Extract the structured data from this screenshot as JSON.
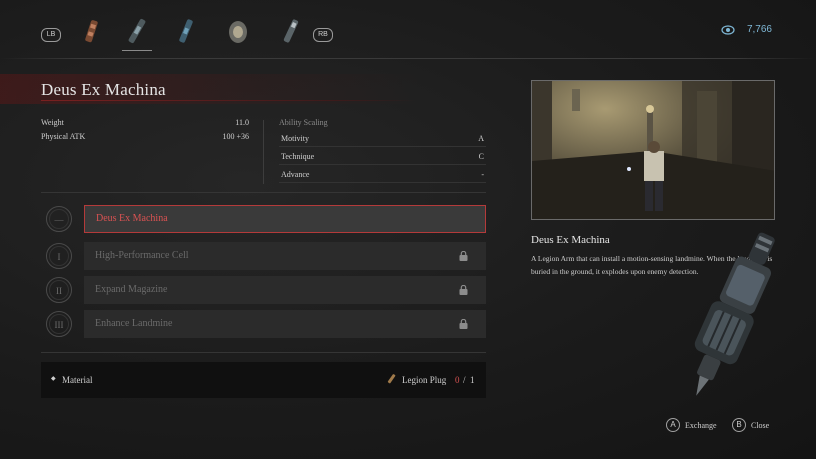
{
  "topbar": {
    "lb": "LB",
    "rb": "RB",
    "tabs": [
      "arm-1",
      "arm-2",
      "arm-3",
      "arm-4",
      "arm-5"
    ],
    "active_tab": 1,
    "currency": "7,766"
  },
  "weapon": {
    "name": "Deus Ex Machina",
    "stats": [
      {
        "label": "Weight",
        "value": "11.0"
      },
      {
        "label": "Physical ATK",
        "value": "100 +36"
      }
    ],
    "scaling_label": "Ability Scaling",
    "scaling": [
      {
        "label": "Motivity",
        "value": "A"
      },
      {
        "label": "Technique",
        "value": "C"
      },
      {
        "label": "Advance",
        "value": "-"
      }
    ]
  },
  "upgrades": [
    {
      "numeral": "—",
      "label": "Deus Ex Machina",
      "locked": false,
      "active": true
    },
    {
      "numeral": "I",
      "label": "High-Performance Cell",
      "locked": true,
      "active": false
    },
    {
      "numeral": "II",
      "label": "Expand Magazine",
      "locked": true,
      "active": false
    },
    {
      "numeral": "III",
      "label": "Enhance Landmine",
      "locked": true,
      "active": false
    }
  ],
  "material": {
    "label": "Material",
    "item": "Legion Plug",
    "have": "0",
    "sep": "/",
    "need": "1"
  },
  "detail": {
    "title": "Deus Ex Machina",
    "description": "A Legion Arm that can install a motion-sensing landmine. When the landmine is buried in the ground, it explodes upon enemy detection."
  },
  "hints": [
    {
      "button": "A",
      "label": "Exchange"
    },
    {
      "button": "B",
      "label": "Close"
    }
  ],
  "colors": {
    "accent_red": "#b43a3a",
    "currency_blue": "#7fb8d6"
  }
}
